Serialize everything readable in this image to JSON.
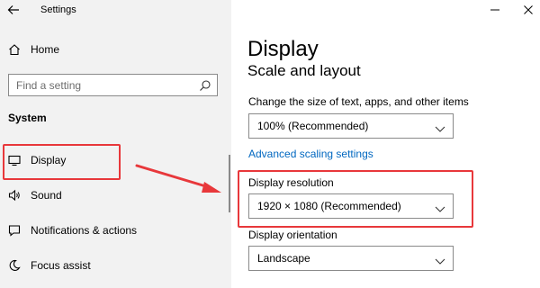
{
  "window": {
    "title": "Settings",
    "back_icon": "back-arrow-icon",
    "minimize_icon": "minimize-icon",
    "close_icon": "close-icon"
  },
  "sidebar": {
    "home": {
      "label": "Home",
      "icon": "home-icon"
    },
    "search": {
      "placeholder": "Find a setting",
      "icon": "search-icon"
    },
    "section_heading": "System",
    "items": [
      {
        "label": "Display",
        "icon": "monitor-icon"
      },
      {
        "label": "Sound",
        "icon": "speaker-icon"
      },
      {
        "label": "Notifications & actions",
        "icon": "notification-icon"
      },
      {
        "label": "Focus assist",
        "icon": "moon-icon"
      }
    ]
  },
  "main": {
    "title": "Display",
    "subsection": "Scale and layout",
    "scale": {
      "label": "Change the size of text, apps, and other items",
      "value": "100% (Recommended)"
    },
    "advanced_link": "Advanced scaling settings",
    "resolution": {
      "label": "Display resolution",
      "value": "1920 × 1080 (Recommended)"
    },
    "orientation": {
      "label": "Display orientation",
      "value": "Landscape"
    }
  },
  "annotations": {
    "highlight_color": "#e8383b"
  }
}
